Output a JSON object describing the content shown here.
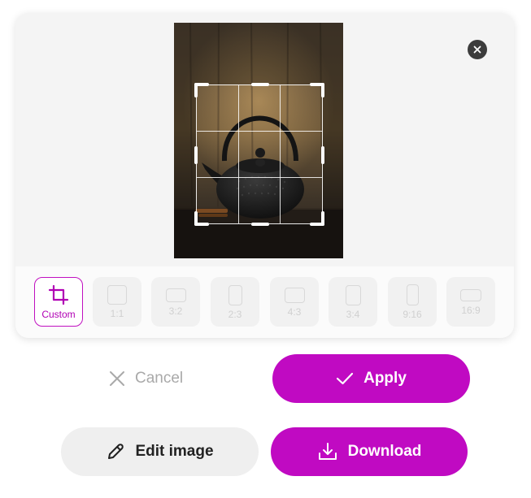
{
  "crop_panel": {
    "close_icon": "close-icon",
    "image_subject": "cast-iron-teapot-photo",
    "crop_grid": "3x3"
  },
  "ratios": [
    {
      "label": "Custom",
      "icon": "crop-icon",
      "active": true
    },
    {
      "label": "1:1",
      "icon": "square-ratio-icon",
      "active": false
    },
    {
      "label": "3:2",
      "icon": "landscape-ratio-icon",
      "active": false
    },
    {
      "label": "2:3",
      "icon": "portrait-ratio-icon",
      "active": false
    },
    {
      "label": "4:3",
      "icon": "landscape-ratio-icon",
      "active": false
    },
    {
      "label": "3:4",
      "icon": "portrait-ratio-icon",
      "active": false
    },
    {
      "label": "9:16",
      "icon": "tall-portrait-ratio-icon",
      "active": false
    },
    {
      "label": "16:9",
      "icon": "wide-landscape-ratio-icon",
      "active": false
    }
  ],
  "actions": {
    "cancel_label": "Cancel",
    "apply_label": "Apply",
    "edit_label": "Edit image",
    "download_label": "Download"
  },
  "colors": {
    "accent": "#c00ac2",
    "muted_text": "#a9a9a9",
    "close_button": "#3c3c3c"
  }
}
